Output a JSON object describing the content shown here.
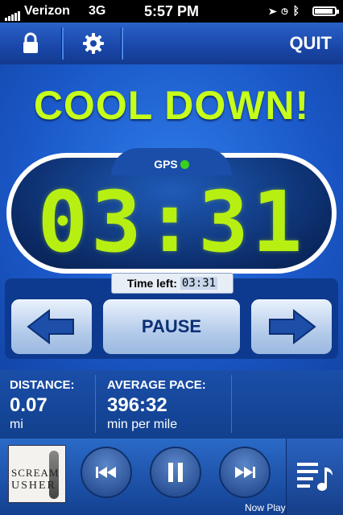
{
  "status_bar": {
    "carrier": "Verizon",
    "network": "3G",
    "time": "5:57 PM"
  },
  "top_nav": {
    "quit_label": "QUIT"
  },
  "workout": {
    "phase_title": "COOL DOWN!",
    "gps_label": "GPS",
    "clock": "03:31",
    "time_left_label": "Time left:",
    "time_left_value": "03:31"
  },
  "controls": {
    "pause_label": "PAUSE"
  },
  "stats": [
    {
      "label": "DISTANCE:",
      "value": "0.07",
      "unit": "mi"
    },
    {
      "label": "AVERAGE PACE:",
      "value": "396:32",
      "unit": "min per mile"
    }
  ],
  "music": {
    "album_art_text_line1": "SCREAM",
    "album_art_text_line2": "USHER",
    "now_playing_label": "Now Play"
  },
  "colors": {
    "accent_green": "#c6ff1a",
    "primary_blue": "#1a58c8",
    "gps_dot": "#3ad020"
  }
}
